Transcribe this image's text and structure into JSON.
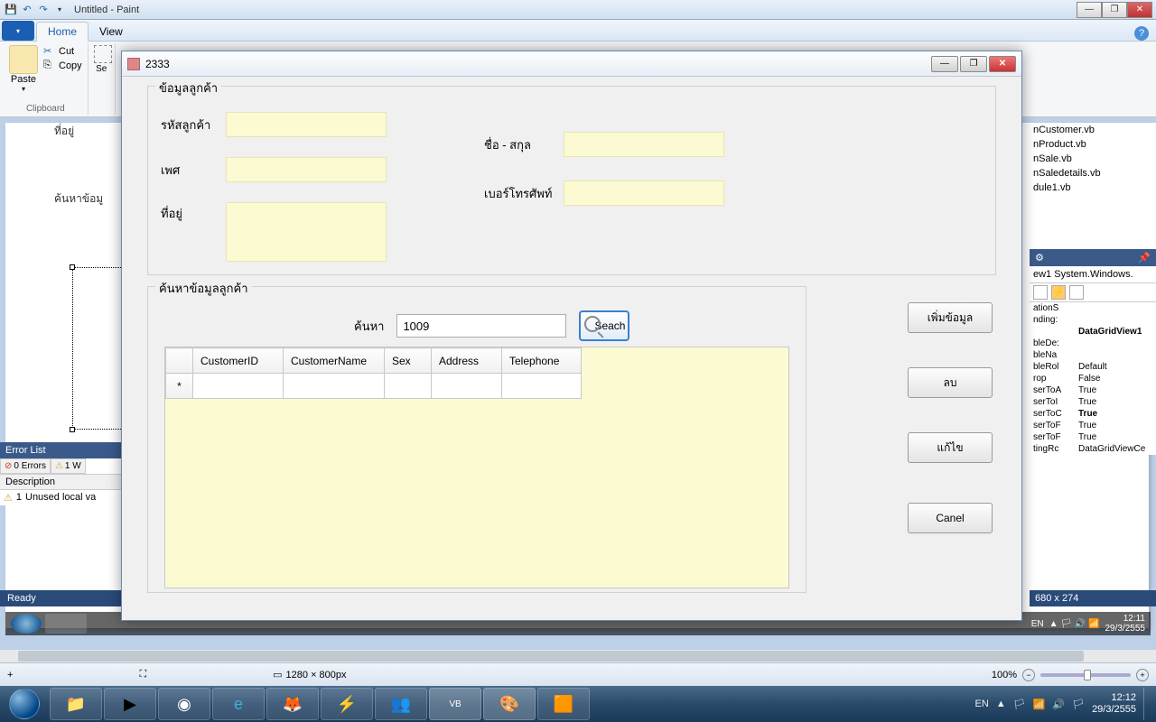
{
  "paint": {
    "title": "Untitled - Paint",
    "tabs": {
      "home": "Home",
      "view": "View"
    },
    "clipboard": {
      "paste": "Paste",
      "cut": "Cut",
      "copy": "Copy",
      "label": "Clipboard"
    },
    "select_label": "Se",
    "status": {
      "cursor_icon": "+",
      "selection_icon": "⛶",
      "size": "1280 × 800px",
      "size_icon": "▭",
      "zoom": "100%"
    }
  },
  "dialog": {
    "title": "2333",
    "group_customer": "ข้อมูลลูกค้า",
    "labels": {
      "customer_id": "รหัสลูกค้า",
      "sex": "เพศ",
      "address": "ที่อยู่",
      "name": "ชื่อ - สกุล",
      "telephone": "เบอร์โทรศัพท์"
    },
    "group_search": "ค้นหาข้อมูลลูกค้า",
    "search_label": "ค้นหา",
    "search_value": "1009",
    "search_button": "Seach",
    "grid": {
      "columns": [
        "CustomerID",
        "CustomerName",
        "Sex",
        "Address",
        "Telephone"
      ],
      "new_row_marker": "*"
    },
    "actions": {
      "add": "เพิ่มข้อมูล",
      "delete": "ลบ",
      "edit": "แก้ไข",
      "cancel": "Canel"
    }
  },
  "vs_background": {
    "labels_left": {
      "address": "ที่อยู่",
      "search": "ค้นหาข้อมู"
    },
    "errorlist": {
      "title": "Error List",
      "errors": "0 Errors",
      "warnings": "1 W",
      "col_desc": "Description",
      "row1_num": "1",
      "row1_text": "Unused local va"
    },
    "ready": "Ready",
    "files": [
      "nCustomer.vb",
      "nProduct.vb",
      "nSale.vb",
      "nSaledetails.vb",
      "dule1.vb"
    ],
    "properties": {
      "header": "ew1  System.Windows.",
      "rows": [
        {
          "k": "ationS",
          "v": ""
        },
        {
          "k": "nding:",
          "v": ""
        },
        {
          "k": "",
          "v": "DataGridView1",
          "bold": true
        },
        {
          "k": "bleDe:",
          "v": ""
        },
        {
          "k": "bleNa",
          "v": ""
        },
        {
          "k": "bleRol",
          "v": "Default"
        },
        {
          "k": "rop",
          "v": "False"
        },
        {
          "k": "serToA",
          "v": "True"
        },
        {
          "k": "serToI",
          "v": "True"
        },
        {
          "k": "serToC",
          "v": "True",
          "bold": true
        },
        {
          "k": "serToF",
          "v": "True"
        },
        {
          "k": "serToF",
          "v": "True"
        },
        {
          "k": "tingRc",
          "v": "DataGridViewCe"
        }
      ],
      "size_status": "680 x 274"
    }
  },
  "captured_tray": {
    "lang": "EN",
    "time": "12:11",
    "date": "29/3/2555"
  },
  "taskbar": {
    "lang": "EN",
    "time": "12:12",
    "date": "29/3/2555"
  }
}
